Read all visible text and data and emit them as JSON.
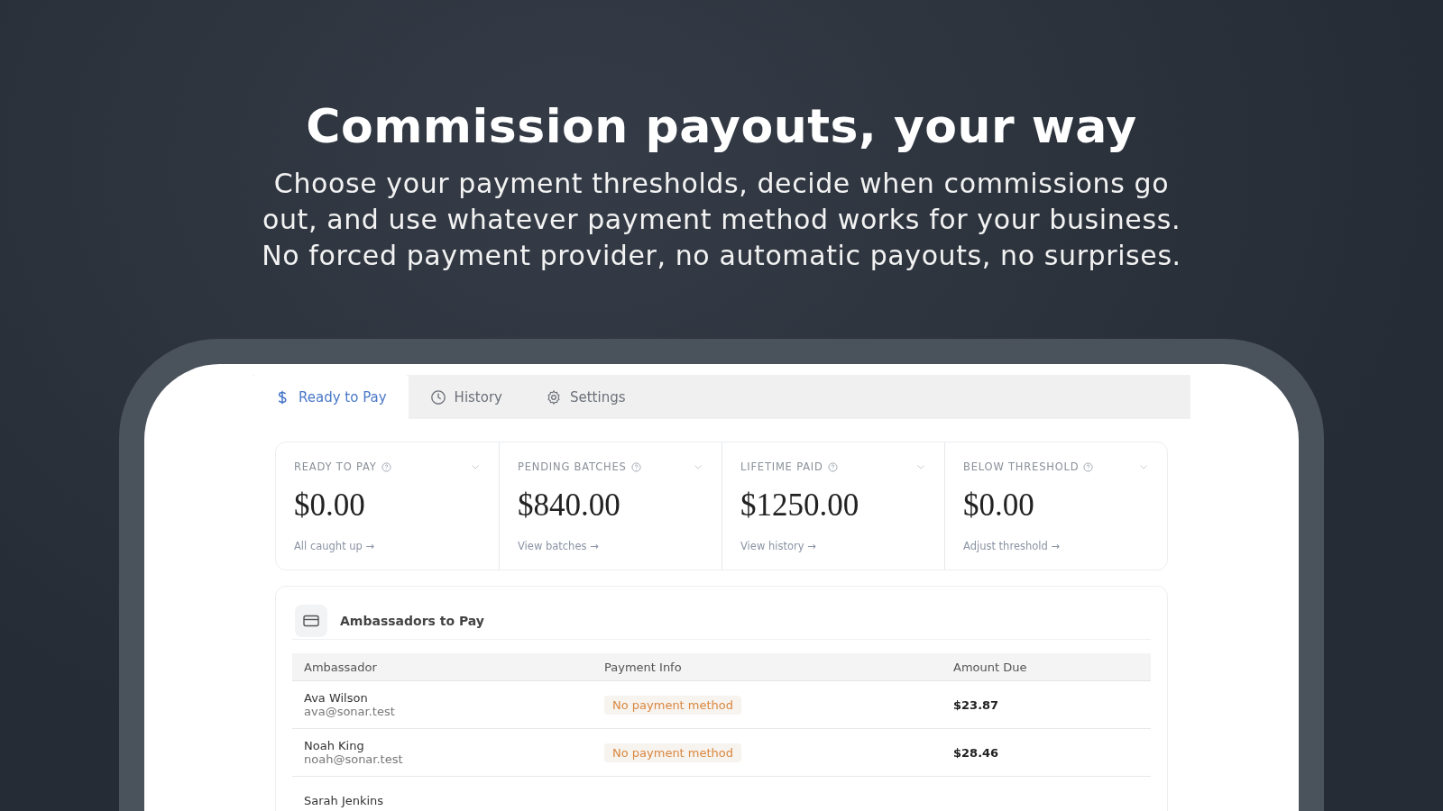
{
  "headline": "Commission payouts, your way",
  "subtitle": "Choose your payment thresholds, decide when commissions go out, and use whatever payment method works for your business. No forced payment provider, no automatic payouts, no surprises.",
  "tabs": [
    {
      "label": "Ready to Pay",
      "kind": "dollar",
      "selected": true
    },
    {
      "label": "History",
      "kind": "clock",
      "selected": false
    },
    {
      "label": "Settings",
      "kind": "gear",
      "selected": false
    }
  ],
  "stats": [
    {
      "label": "READY TO PAY",
      "value": "$0.00",
      "link": "All caught up →"
    },
    {
      "label": "PENDING BATCHES",
      "value": "$840.00",
      "link": "View batches →"
    },
    {
      "label": "LIFETIME PAID",
      "value": "$1250.00",
      "link": "View history →"
    },
    {
      "label": "BELOW THRESHOLD",
      "value": "$0.00",
      "link": "Adjust threshold →"
    }
  ],
  "table": {
    "title": "Ambassadors to Pay",
    "columns": [
      "Ambassador",
      "Payment Info",
      "Amount Due"
    ],
    "rows": [
      {
        "name": "Ava Wilson",
        "email": "ava@sonar.test",
        "payment": "No payment method",
        "amount": "$23.87"
      },
      {
        "name": "Noah King",
        "email": "noah@sonar.test",
        "payment": "No payment method",
        "amount": "$28.46"
      },
      {
        "name": "Sarah Jenkins"
      }
    ]
  }
}
